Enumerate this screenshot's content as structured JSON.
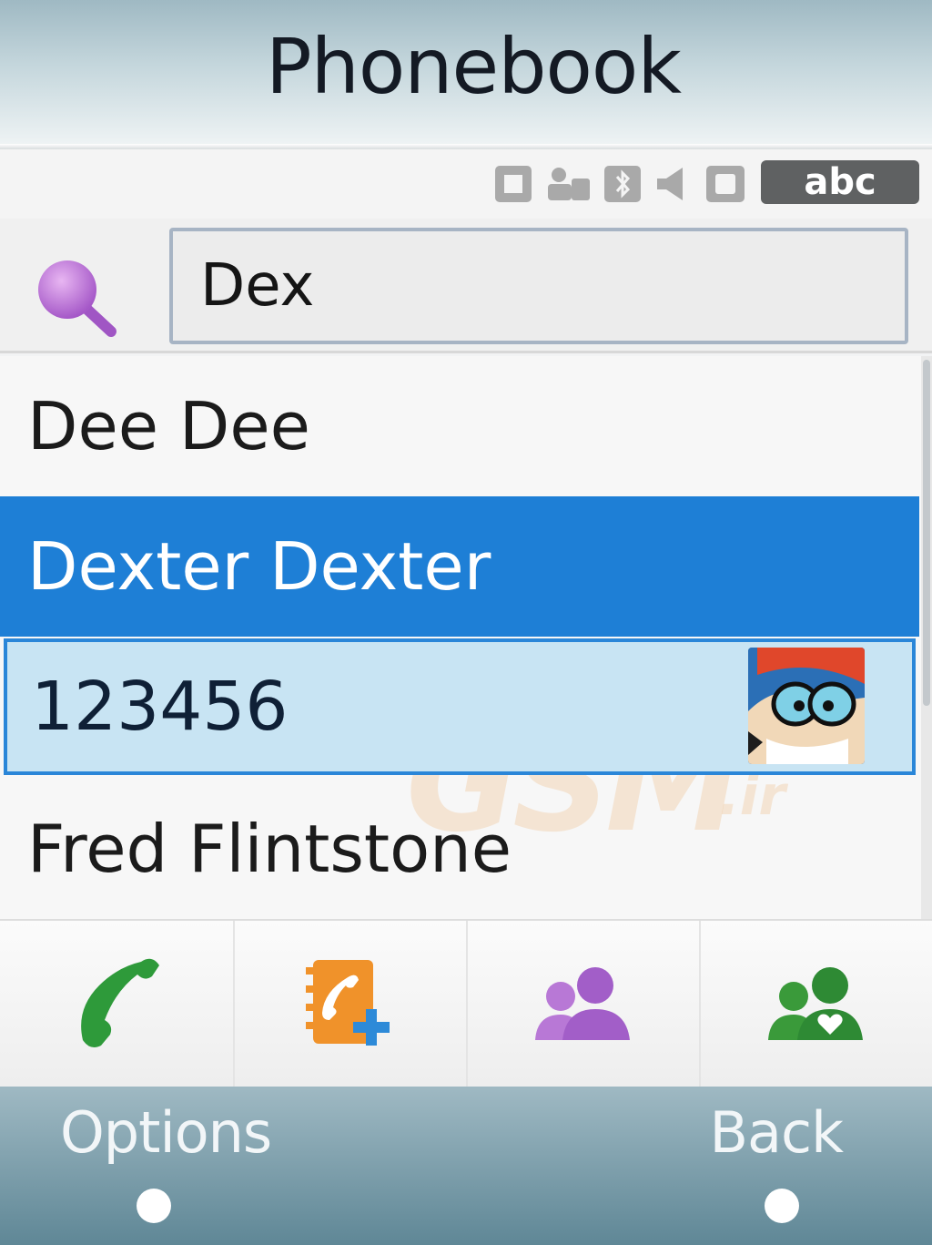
{
  "header": {
    "title": "Phonebook"
  },
  "status_bar": {
    "icons": [
      "sim-icon",
      "profile-icon",
      "bluetooth-icon",
      "speaker-icon",
      "memory-icon"
    ],
    "input_mode": "abc"
  },
  "search": {
    "value": "Dex",
    "icon": "search-icon"
  },
  "contacts": [
    {
      "name": "Dee Dee"
    },
    {
      "name": "Dexter Dexter",
      "selected": true,
      "number": "123456",
      "has_photo": true
    },
    {
      "name": "Fred Flintstone"
    }
  ],
  "watermark": {
    "text": "GSM",
    "suffix": ".ir"
  },
  "actions": [
    {
      "icon": "call-icon"
    },
    {
      "icon": "add-contact-icon"
    },
    {
      "icon": "groups-icon"
    },
    {
      "icon": "favorites-icon"
    }
  ],
  "softkeys": {
    "left": "Options",
    "right": "Back"
  },
  "colors": {
    "selection": "#1e7fd6",
    "detail_bg": "#c8e4f3",
    "input_mode_badge": "#5f6162",
    "call_green": "#2e9a3a",
    "group_purple": "#a25ec8"
  }
}
